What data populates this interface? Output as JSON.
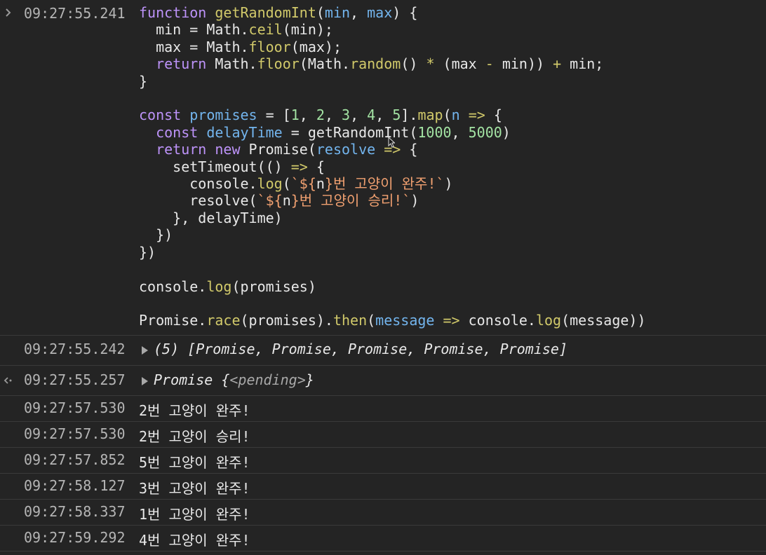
{
  "colors": {
    "background": "#242424",
    "divider": "#3a3a3a",
    "keyword": "#bd93f9",
    "function": "#d1c96a",
    "variable": "#73b5ee",
    "number": "#a3e3a3",
    "string": "#f0a070"
  },
  "icons": {
    "input": "chevron-right-icon",
    "return": "return-arrow-icon",
    "expand": "expand-triangle-icon",
    "cursor": "mouse-pointer-icon"
  },
  "input": {
    "timestamp": "09:27:55.241",
    "code": [
      [
        [
          "kw",
          "function "
        ],
        [
          "fn",
          "getRandomInt"
        ],
        [
          "pl",
          "("
        ],
        [
          "var",
          "min"
        ],
        [
          "pl",
          ", "
        ],
        [
          "var",
          "max"
        ],
        [
          "pl",
          ") {"
        ]
      ],
      [
        [
          "pl",
          "  min = Math."
        ],
        [
          "fn",
          "ceil"
        ],
        [
          "pl",
          "(min);"
        ]
      ],
      [
        [
          "pl",
          "  max = Math."
        ],
        [
          "fn",
          "floor"
        ],
        [
          "pl",
          "(max);"
        ]
      ],
      [
        [
          "kw",
          "  return "
        ],
        [
          "pl",
          "Math."
        ],
        [
          "fn",
          "floor"
        ],
        [
          "pl",
          "(Math."
        ],
        [
          "fn",
          "random"
        ],
        [
          "pl",
          "() "
        ],
        [
          "fn",
          "*"
        ],
        [
          "pl",
          " (max "
        ],
        [
          "fn",
          "-"
        ],
        [
          "pl",
          " min)) "
        ],
        [
          "fn",
          "+"
        ],
        [
          "pl",
          " min;"
        ]
      ],
      [
        [
          "pl",
          "}"
        ]
      ],
      [],
      [
        [
          "kw",
          "const "
        ],
        [
          "var",
          "promises"
        ],
        [
          "pl",
          " = ["
        ],
        [
          "num",
          "1"
        ],
        [
          "pl",
          ", "
        ],
        [
          "num",
          "2"
        ],
        [
          "pl",
          ", "
        ],
        [
          "num",
          "3"
        ],
        [
          "pl",
          ", "
        ],
        [
          "num",
          "4"
        ],
        [
          "pl",
          ", "
        ],
        [
          "num",
          "5"
        ],
        [
          "pl",
          "]."
        ],
        [
          "fn",
          "map"
        ],
        [
          "pl",
          "("
        ],
        [
          "var",
          "n"
        ],
        [
          "fn",
          " =>"
        ],
        [
          "pl",
          " {"
        ]
      ],
      [
        [
          "kw",
          "  const "
        ],
        [
          "var",
          "delayTime"
        ],
        [
          "pl",
          " = getRandomInt("
        ],
        [
          "num",
          "1000"
        ],
        [
          "pl",
          ", "
        ],
        [
          "num",
          "5000"
        ],
        [
          "pl",
          ")"
        ]
      ],
      [
        [
          "kw",
          "  return new "
        ],
        [
          "pl",
          "Promise("
        ],
        [
          "var",
          "resolve"
        ],
        [
          "fn",
          " =>"
        ],
        [
          "pl",
          " {"
        ]
      ],
      [
        [
          "pl",
          "    setTimeout(() "
        ],
        [
          "fn",
          "=>"
        ],
        [
          "pl",
          " {"
        ]
      ],
      [
        [
          "pl",
          "      console."
        ],
        [
          "fn",
          "log"
        ],
        [
          "pl",
          "("
        ],
        [
          "str",
          "`${"
        ],
        [
          "pl",
          "n"
        ],
        [
          "str",
          "}번 고양이 완주!`"
        ],
        [
          "pl",
          ")"
        ]
      ],
      [
        [
          "pl",
          "      resolve("
        ],
        [
          "str",
          "`${"
        ],
        [
          "pl",
          "n"
        ],
        [
          "str",
          "}번 고양이 승리!`"
        ],
        [
          "pl",
          ")"
        ]
      ],
      [
        [
          "pl",
          "    }, delayTime)"
        ]
      ],
      [
        [
          "pl",
          "  })"
        ]
      ],
      [
        [
          "pl",
          "})"
        ]
      ],
      [],
      [
        [
          "pl",
          "console."
        ],
        [
          "fn",
          "log"
        ],
        [
          "pl",
          "(promises)"
        ]
      ],
      [],
      [
        [
          "pl",
          "Promise."
        ],
        [
          "fn",
          "race"
        ],
        [
          "pl",
          "(promises)."
        ],
        [
          "fn",
          "then"
        ],
        [
          "pl",
          "("
        ],
        [
          "var",
          "message"
        ],
        [
          "fn",
          " =>"
        ],
        [
          "pl",
          " console."
        ],
        [
          "fn",
          "log"
        ],
        [
          "pl",
          "(message))"
        ]
      ]
    ]
  },
  "output_array": {
    "timestamp": "09:27:55.242",
    "text": "(5) [Promise, Promise, Promise, Promise, Promise]"
  },
  "return_value": {
    "timestamp": "09:27:55.257",
    "prefix": "Promise {",
    "state": "<pending>",
    "suffix": "}"
  },
  "logs": [
    {
      "timestamp": "09:27:57.530",
      "message": "2번 고양이 완주!"
    },
    {
      "timestamp": "09:27:57.530",
      "message": "2번 고양이 승리!"
    },
    {
      "timestamp": "09:27:57.852",
      "message": "5번 고양이 완주!"
    },
    {
      "timestamp": "09:27:58.127",
      "message": "3번 고양이 완주!"
    },
    {
      "timestamp": "09:27:58.337",
      "message": "1번 고양이 완주!"
    },
    {
      "timestamp": "09:27:59.292",
      "message": "4번 고양이 완주!"
    }
  ]
}
